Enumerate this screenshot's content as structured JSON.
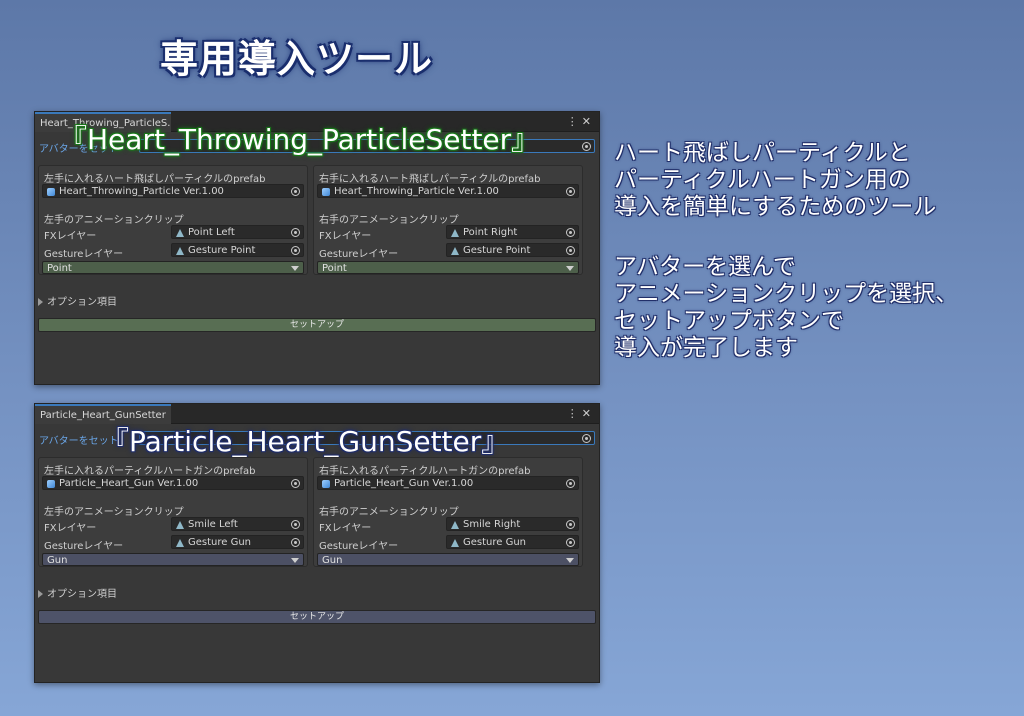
{
  "page_title": "専用導入ツール",
  "description_1": [
    "ハート飛ばしパーティクルと",
    "パーティクルハートガン用の",
    "導入を簡単にするためのツール"
  ],
  "description_2": [
    "アバターを選んで",
    "アニメーションクリップを選択、",
    "セットアップボタンで",
    "導入が完了します"
  ],
  "window1": {
    "tab": "Heart_Throwing_ParticleS...",
    "overlay_title": "『Heart_Throwing_ParticleSetter』",
    "avatar_label": "アバターをセット",
    "left": {
      "prefab_label": "左手に入れるハート飛ばしパーティクルのprefab",
      "prefab_value": "Heart_Throwing_Particle Ver.1.00",
      "clip_label": "左手のアニメーションクリップ",
      "fx_label": "FXレイヤー",
      "fx_value": "Point Left",
      "gesture_label": "Gestureレイヤー",
      "gesture_value": "Gesture Point",
      "dropdown": "Point"
    },
    "right": {
      "prefab_label": "右手に入れるハート飛ばしパーティクルのprefab",
      "prefab_value": "Heart_Throwing_Particle Ver.1.00",
      "clip_label": "右手のアニメーションクリップ",
      "fx_label": "FXレイヤー",
      "fx_value": "Point Right",
      "gesture_label": "Gestureレイヤー",
      "gesture_value": "Gesture Point",
      "dropdown": "Point"
    },
    "options_label": "オプション項目",
    "setup_button": "セットアップ"
  },
  "window2": {
    "tab": "Particle_Heart_GunSetter",
    "overlay_title": "『Particle_Heart_GunSetter』",
    "avatar_label": "アバターをセット",
    "left": {
      "prefab_label": "左手に入れるパーティクルハートガンのprefab",
      "prefab_value": "Particle_Heart_Gun Ver.1.00",
      "clip_label": "左手のアニメーションクリップ",
      "fx_label": "FXレイヤー",
      "fx_value": "Smile Left",
      "gesture_label": "Gestureレイヤー",
      "gesture_value": "Gesture Gun",
      "dropdown": "Gun"
    },
    "right": {
      "prefab_label": "右手に入れるパーティクルハートガンのprefab",
      "prefab_value": "Particle_Heart_Gun Ver.1.00",
      "clip_label": "右手のアニメーションクリップ",
      "fx_label": "FXレイヤー",
      "fx_value": "Smile Right",
      "gesture_label": "Gestureレイヤー",
      "gesture_value": "Gesture Gun",
      "dropdown": "Gun"
    },
    "options_label": "オプション項目",
    "setup_button": "セットアップ"
  },
  "icons": {
    "menu": "kebab-menu-icon",
    "close": "close-icon",
    "object_picker": "object-picker-icon",
    "prefab": "prefab-icon",
    "animation_clip": "animation-clip-icon",
    "foldout": "foldout-triangle-icon",
    "dropdown": "chevron-down-icon"
  },
  "colors": {
    "accent_blue": "#3a79bb",
    "setup_green": "#586e53",
    "setup_blue": "#4e5369"
  }
}
